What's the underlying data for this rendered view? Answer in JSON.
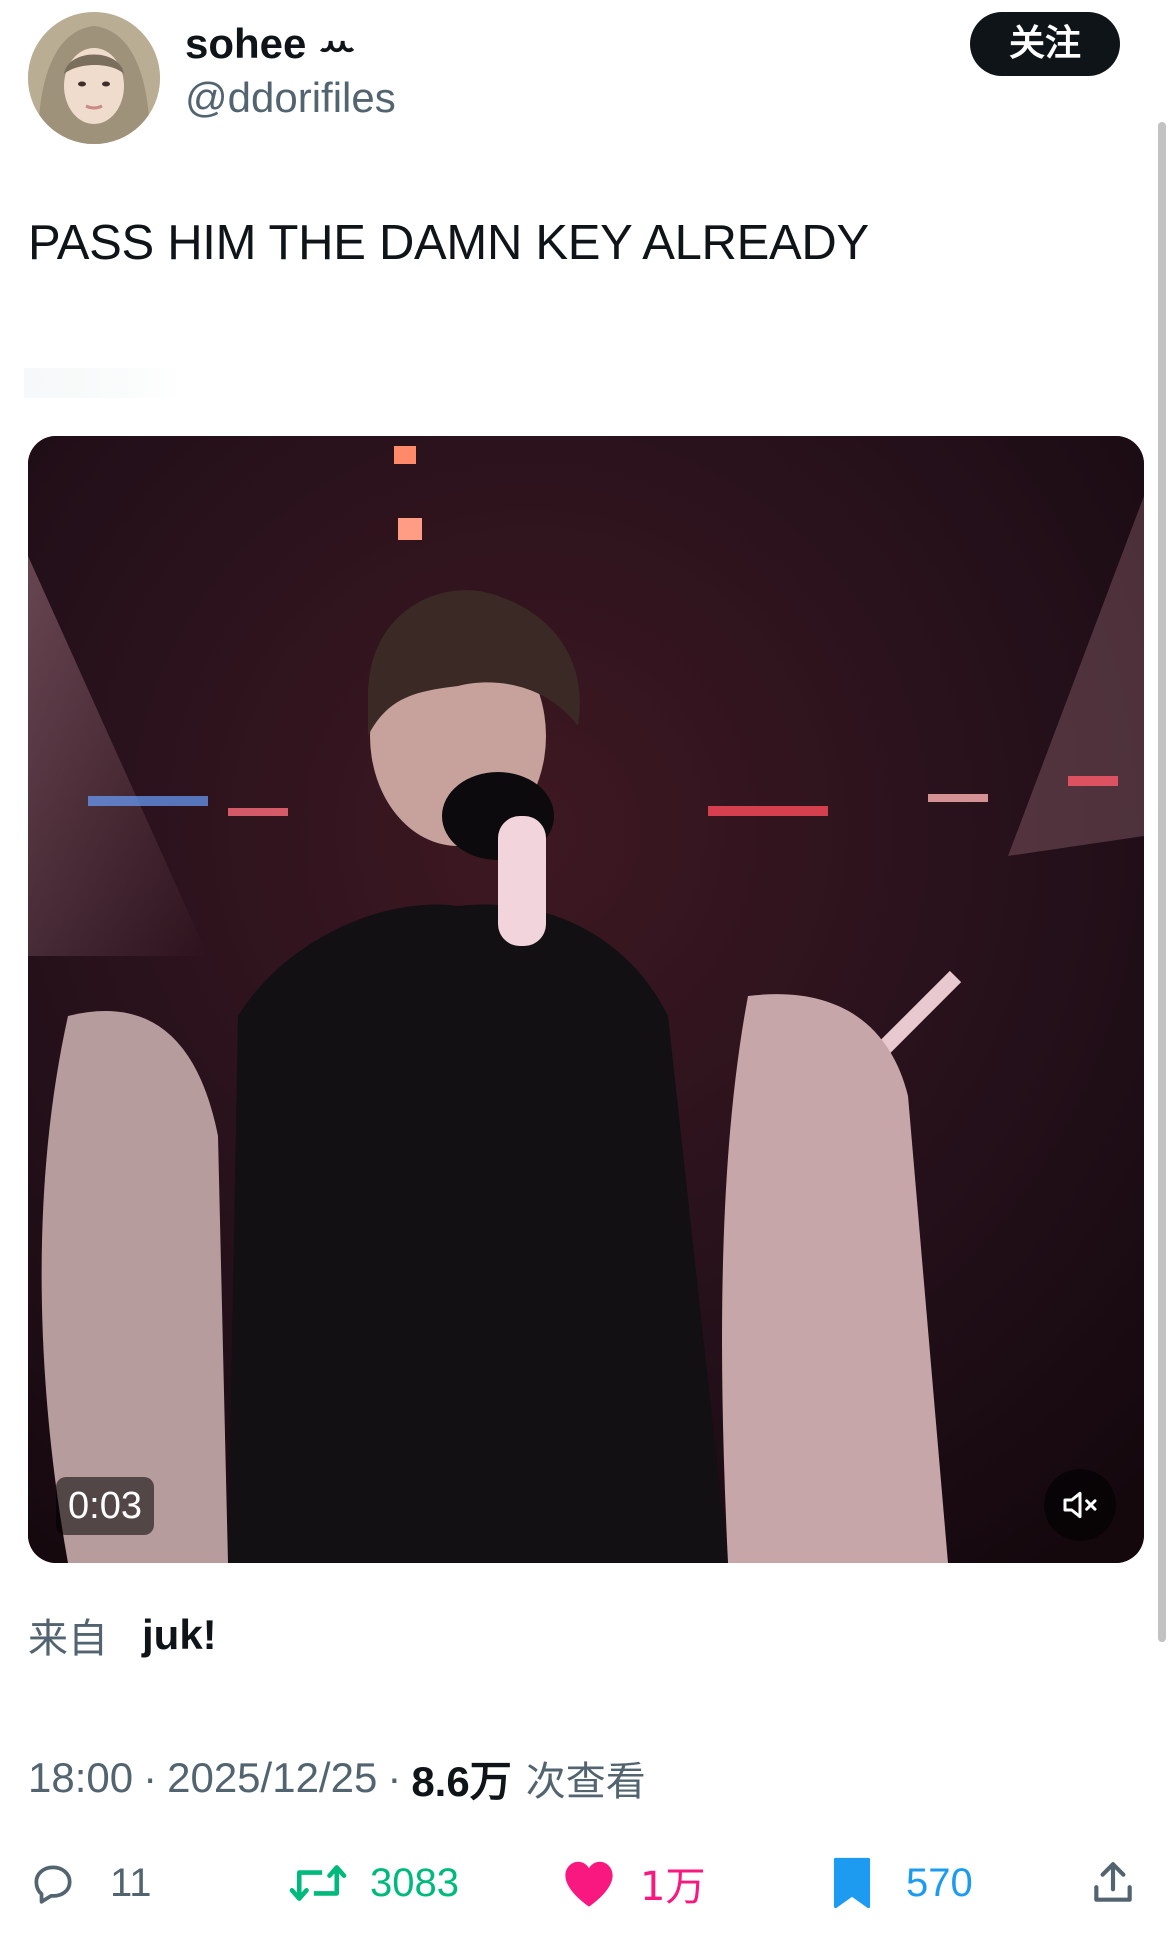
{
  "author": {
    "display_name": "sohee ꕀ",
    "handle": "@ddorifiles",
    "follow_label": "关注"
  },
  "tweet": {
    "text": "PASS HIM THE DAMN KEY ALREADY"
  },
  "media": {
    "timestamp": "0:03",
    "mute_icon": "volume-muted-icon"
  },
  "source": {
    "label": "来自",
    "name": "juk!"
  },
  "meta": {
    "time": "18:00",
    "separator": "·",
    "date": "2025/12/25",
    "views": "8.6万",
    "views_label": "次查看"
  },
  "actions": {
    "reply_count": "11",
    "retweet_count": "3083",
    "like_count": "1万",
    "bookmark_count": "570"
  },
  "colors": {
    "retweet": "#00ba7c",
    "like": "#f91880",
    "bookmark": "#1d9bf0",
    "muted_text": "#536471"
  }
}
